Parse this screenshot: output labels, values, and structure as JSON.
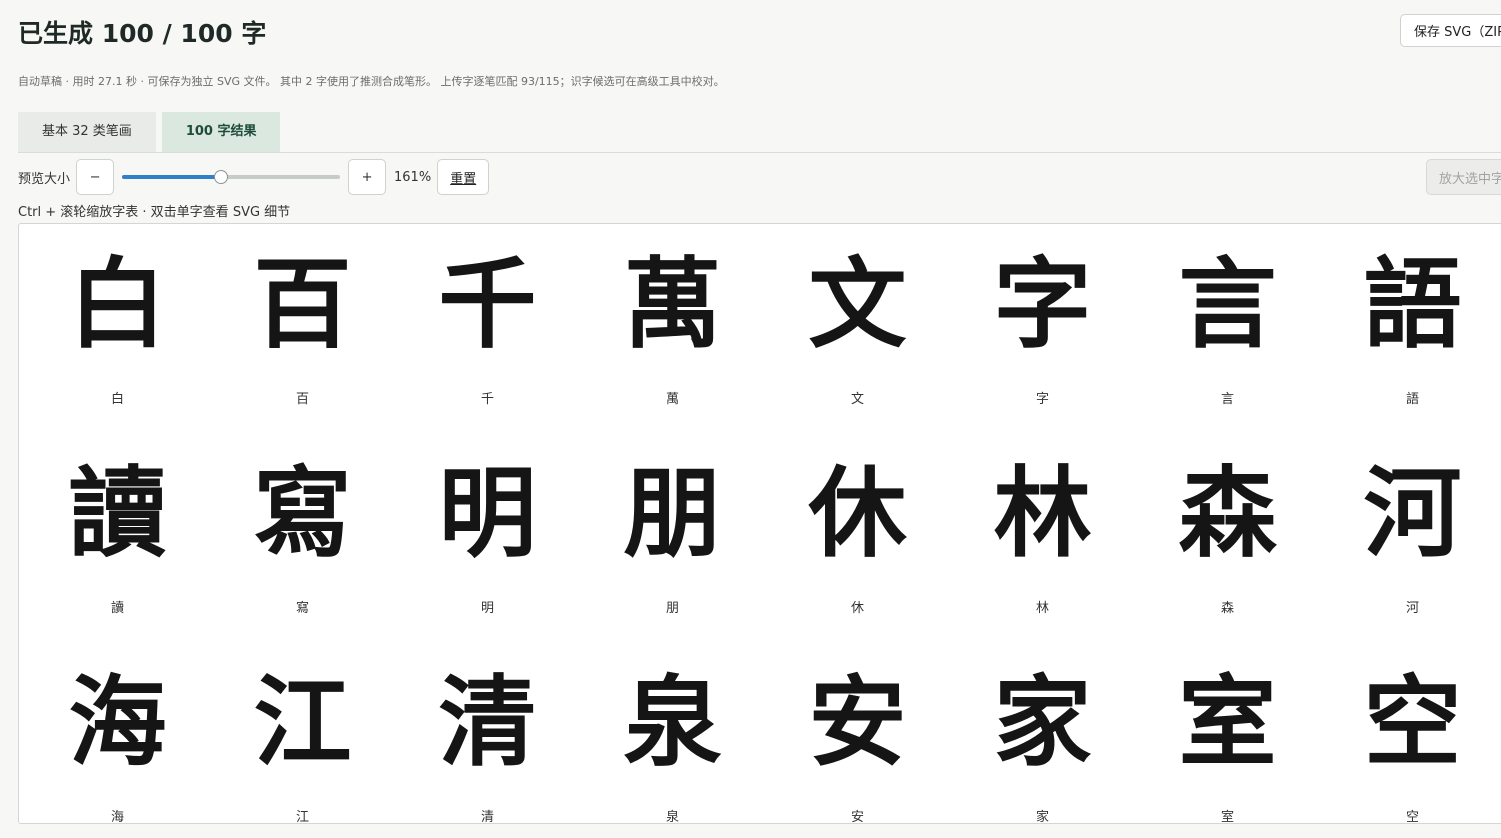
{
  "header": {
    "title": "已生成 100 / 100 字",
    "save_label": "保存 SVG（ZIP）",
    "subtitle": "自动草稿 · 用时 27.1 秒 · 可保存为独立 SVG 文件。 其中 2 字使用了推测合成笔形。 上传字逐笔匹配 93/115；识字候选可在高级工具中校对。"
  },
  "tabs": [
    {
      "label": "基本 32 类笔画",
      "active": false
    },
    {
      "label": "100 字结果",
      "active": true
    }
  ],
  "toolbar": {
    "preview_label": "预览大小",
    "minus_label": "−",
    "plus_label": "+",
    "zoom_percent": 161,
    "zoom_text": "161%",
    "slider_fraction": 0.45,
    "reset_label": "重置",
    "enlarge_label": "放大选中字"
  },
  "hint": "Ctrl + 滚轮缩放字表 · 双击单字查看 SVG 细节",
  "glyphs": [
    {
      "char": "白",
      "label": "白"
    },
    {
      "char": "百",
      "label": "百"
    },
    {
      "char": "千",
      "label": "千"
    },
    {
      "char": "萬",
      "label": "萬"
    },
    {
      "char": "文",
      "label": "文"
    },
    {
      "char": "字",
      "label": "字"
    },
    {
      "char": "言",
      "label": "言"
    },
    {
      "char": "語",
      "label": "語"
    },
    {
      "char": "讀",
      "label": "讀"
    },
    {
      "char": "寫",
      "label": "寫"
    },
    {
      "char": "明",
      "label": "明"
    },
    {
      "char": "朋",
      "label": "朋"
    },
    {
      "char": "休",
      "label": "休"
    },
    {
      "char": "林",
      "label": "林"
    },
    {
      "char": "森",
      "label": "森"
    },
    {
      "char": "河",
      "label": "河"
    },
    {
      "char": "海",
      "label": "海"
    },
    {
      "char": "江",
      "label": "江"
    },
    {
      "char": "清",
      "label": "清"
    },
    {
      "char": "泉",
      "label": "泉"
    },
    {
      "char": "安",
      "label": "安"
    },
    {
      "char": "家",
      "label": "家"
    },
    {
      "char": "室",
      "label": "室"
    },
    {
      "char": "空",
      "label": "空"
    }
  ]
}
